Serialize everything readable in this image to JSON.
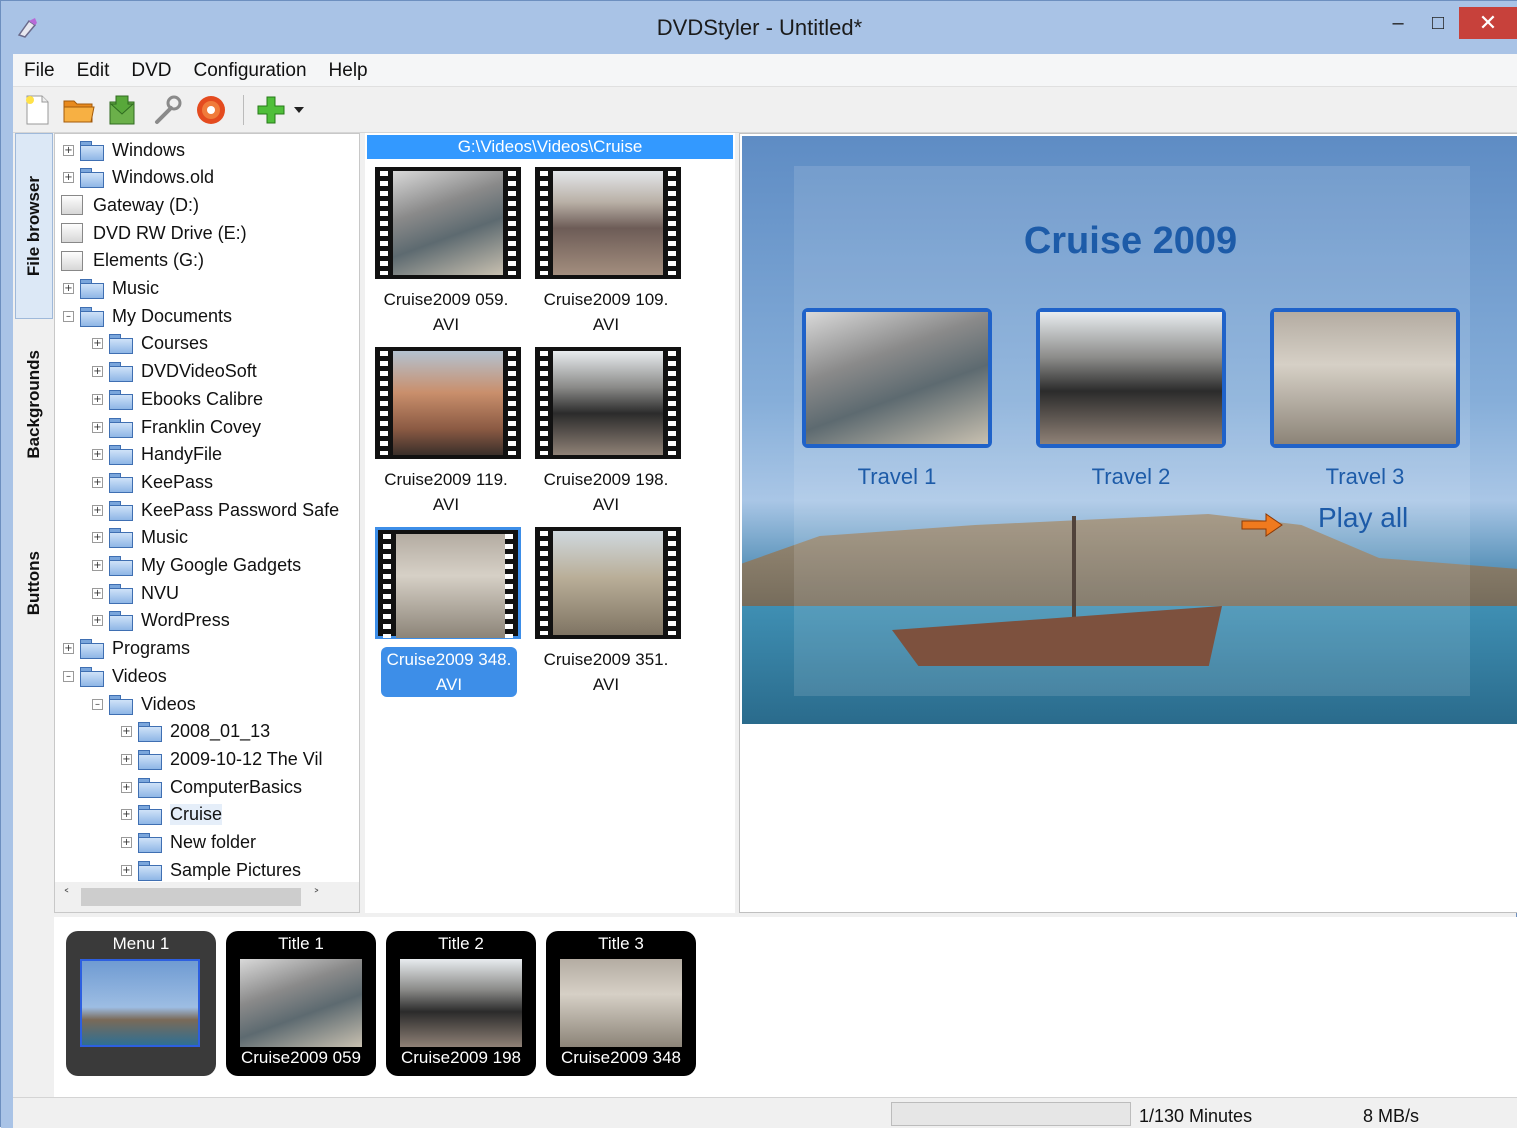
{
  "window": {
    "title": "DVDStyler - Untitled*",
    "controls": {
      "minimize": "–",
      "maximize": "□",
      "close": "✕"
    }
  },
  "menu": [
    "File",
    "Edit",
    "DVD",
    "Configuration",
    "Help"
  ],
  "toolbar": {
    "icons": [
      "new-file-icon",
      "open-folder-icon",
      "save-icon",
      "settings-wrench-icon",
      "burn-disc-icon",
      "add-icon",
      "dropdown-arrow-icon"
    ]
  },
  "side_tabs": [
    "File browser",
    "Backgrounds",
    "Buttons"
  ],
  "tree": [
    {
      "label": "Windows",
      "type": "folder",
      "level": 1,
      "expander": "+"
    },
    {
      "label": "Windows.old",
      "type": "folder",
      "level": 1,
      "expander": "+"
    },
    {
      "label": "Gateway (D:)",
      "type": "drive",
      "level": 0
    },
    {
      "label": "DVD RW Drive (E:)",
      "type": "drive",
      "level": 0
    },
    {
      "label": "Elements (G:)",
      "type": "drive",
      "level": 0
    },
    {
      "label": "Music",
      "type": "folder",
      "level": 1,
      "expander": "+"
    },
    {
      "label": "My Documents",
      "type": "folder",
      "level": 1,
      "expander": "–"
    },
    {
      "label": "Courses",
      "type": "folder",
      "level": 2,
      "expander": "+"
    },
    {
      "label": "DVDVideoSoft",
      "type": "folder",
      "level": 2,
      "expander": "+"
    },
    {
      "label": "Ebooks Calibre",
      "type": "folder",
      "level": 2,
      "expander": "+"
    },
    {
      "label": "Franklin Covey",
      "type": "folder",
      "level": 2,
      "expander": "+"
    },
    {
      "label": "HandyFile",
      "type": "folder",
      "level": 2,
      "expander": "+"
    },
    {
      "label": "KeePass",
      "type": "folder",
      "level": 2,
      "expander": "+"
    },
    {
      "label": "KeePass Password Safe",
      "type": "folder",
      "level": 2,
      "expander": "+"
    },
    {
      "label": "Music",
      "type": "folder",
      "level": 2,
      "expander": "+"
    },
    {
      "label": "My Google Gadgets",
      "type": "folder",
      "level": 2,
      "expander": "+"
    },
    {
      "label": "NVU",
      "type": "folder",
      "level": 2,
      "expander": "+"
    },
    {
      "label": "WordPress",
      "type": "folder",
      "level": 2,
      "expander": "+"
    },
    {
      "label": "Programs",
      "type": "folder",
      "level": 1,
      "expander": "+"
    },
    {
      "label": "Videos",
      "type": "folder",
      "level": 1,
      "expander": "–"
    },
    {
      "label": "Videos",
      "type": "folder",
      "level": 2,
      "expander": "–"
    },
    {
      "label": "2008_01_13",
      "type": "folder",
      "level": 3,
      "expander": "+"
    },
    {
      "label": "2009-10-12 The Vil",
      "type": "folder",
      "level": 3,
      "expander": "+"
    },
    {
      "label": "ComputerBasics",
      "type": "folder",
      "level": 3,
      "expander": "+"
    },
    {
      "label": "Cruise",
      "type": "folder",
      "level": 3,
      "expander": "+",
      "selected": true
    },
    {
      "label": "New folder",
      "type": "folder",
      "level": 3,
      "expander": "+"
    },
    {
      "label": "Sample Pictures",
      "type": "folder",
      "level": 3,
      "expander": "+"
    }
  ],
  "scroll": {
    "up": "˄",
    "down": "˅",
    "left": "˂",
    "right": "˃"
  },
  "files": {
    "path": "G:\\Videos\\Videos\\Cruise",
    "items": [
      {
        "name": "Cruise2009 059.",
        "ext": "AVI",
        "photo": "ph1"
      },
      {
        "name": "Cruise2009 109.",
        "ext": "AVI",
        "photo": "ph2"
      },
      {
        "name": "Cruise2009 119.",
        "ext": "AVI",
        "photo": "ph3"
      },
      {
        "name": "Cruise2009 198.",
        "ext": "AVI",
        "photo": "ph4"
      },
      {
        "name": "Cruise2009 348.",
        "ext": "AVI",
        "photo": "ph5",
        "selected": true
      },
      {
        "name": "Cruise2009 351.",
        "ext": "AVI",
        "photo": "ph6"
      }
    ]
  },
  "menu_preview": {
    "title": "Cruise 2009",
    "buttons": [
      {
        "label": "Travel 1",
        "photo": "ph1"
      },
      {
        "label": "Travel 2",
        "photo": "ph4"
      },
      {
        "label": "Travel 3",
        "photo": "ph5"
      }
    ],
    "play_all": "Play all"
  },
  "titleset": [
    {
      "top": "Menu 1",
      "bottom": "",
      "kind": "menu",
      "photo": "ph-menu"
    },
    {
      "top": "Title 1",
      "bottom": "Cruise2009 059",
      "kind": "title",
      "photo": "ph1"
    },
    {
      "top": "Title 2",
      "bottom": "Cruise2009 198",
      "kind": "title",
      "photo": "ph4"
    },
    {
      "top": "Title 3",
      "bottom": "Cruise2009 348",
      "kind": "title",
      "photo": "ph5"
    }
  ],
  "status": {
    "minutes": "1/130 Minutes",
    "rate": "8 MB/s"
  },
  "colors": {
    "accent": "#3399ff",
    "menu_text": "#1d5ba8",
    "title_bar": "#a9c3e6",
    "close": "#c7413b"
  }
}
